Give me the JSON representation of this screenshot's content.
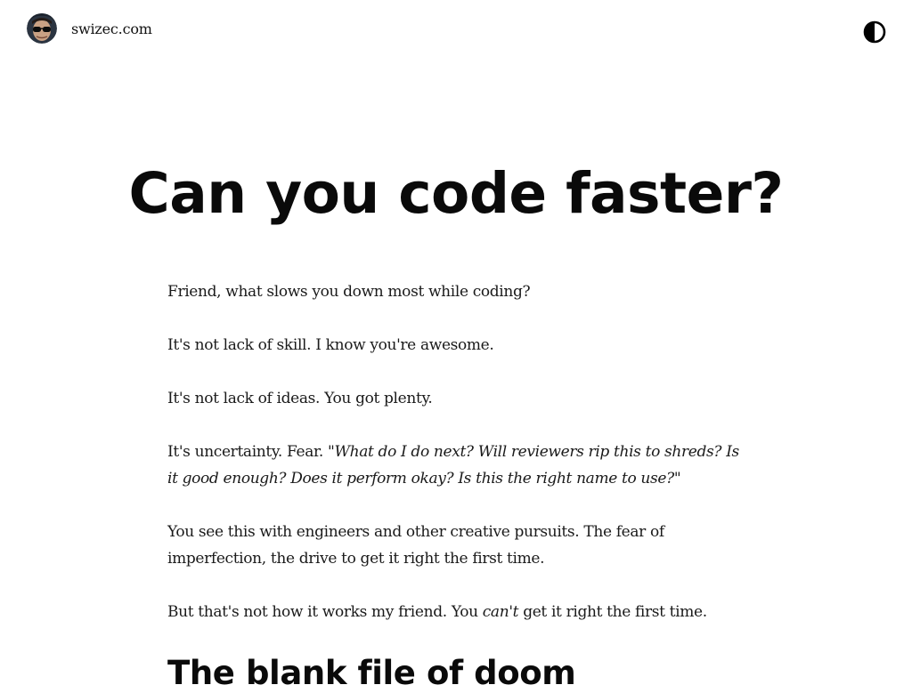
{
  "header": {
    "site_name": "swizec.com",
    "avatar_icon": "avatar-photo-icon",
    "theme_toggle_icon": "contrast-half-circle-icon"
  },
  "article": {
    "title": "Can you code faster?",
    "paragraphs": {
      "p1": "Friend, what slows you down most while coding?",
      "p2": "It's not lack of skill. I know you're awesome.",
      "p3": "It's not lack of ideas. You got plenty.",
      "p4_lead": "It's uncertainty. Fear. ",
      "p4_quote": "\"What do I do next? Will reviewers rip this to shreds? Is it good enough? Does it perform okay? Is this the right name to use?\"",
      "p5": "You see this with engineers and other creative pursuits. The fear of imperfection, the drive to get it right the first time.",
      "p6_lead": "But that's not how it works my friend. You ",
      "p6_em": "can't",
      "p6_tail": " get it right the first time."
    },
    "subheading": "The blank file of doom"
  },
  "colors": {
    "background": "#ffffff",
    "text": "#111111"
  }
}
